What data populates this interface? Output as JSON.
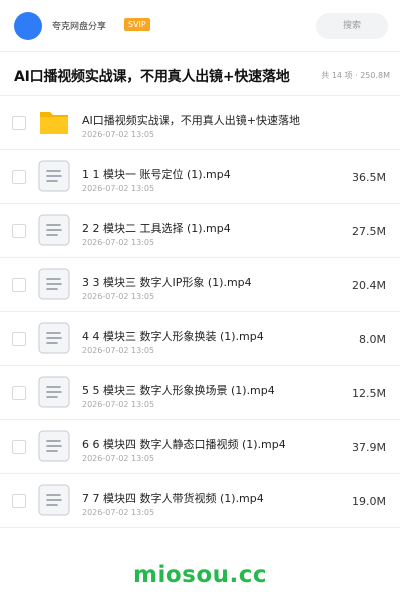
{
  "header": {
    "site_name": "夸克网盘分享",
    "badge": "SVIP",
    "search_placeholder": "搜索",
    "avatar_color": "#2f7df6"
  },
  "share": {
    "title": "AI口播视频实战课，不用真人出镜+快速落地",
    "meta": "共 14 项 · 250.8M"
  },
  "files": [
    {
      "name": "AI口播视频实战课，不用真人出镜+快速落地",
      "date": "2026-07-02 13:05",
      "size": "",
      "icon": "folder-icon"
    },
    {
      "name": "1 1 模块一 账号定位 (1).mp4",
      "date": "2026-07-02 13:05",
      "size": "36.5M",
      "icon": "video-file-icon"
    },
    {
      "name": "2 2 模块二 工具选择 (1).mp4",
      "date": "2026-07-02 13:05",
      "size": "27.5M",
      "icon": "video-file-icon"
    },
    {
      "name": "3 3 模块三 数字人IP形象 (1).mp4",
      "date": "2026-07-02 13:05",
      "size": "20.4M",
      "icon": "video-file-icon"
    },
    {
      "name": "4 4 模块三 数字人形象换装 (1).mp4",
      "date": "2026-07-02 13:05",
      "size": "8.0M",
      "icon": "video-file-icon"
    },
    {
      "name": "5 5 模块三 数字人形象换场景 (1).mp4",
      "date": "2026-07-02 13:05",
      "size": "12.5M",
      "icon": "video-file-icon"
    },
    {
      "name": "6 6 模块四 数字人静态口播视频 (1).mp4",
      "date": "2026-07-02 13:05",
      "size": "37.9M",
      "icon": "video-file-icon"
    },
    {
      "name": "7 7 模块四 数字人带货视频 (1).mp4",
      "date": "2026-07-02 13:05",
      "size": "19.0M",
      "icon": "video-file-icon"
    }
  ],
  "footer": {
    "watermark": "miosou.cc",
    "watermark_color": "#26b84c"
  }
}
